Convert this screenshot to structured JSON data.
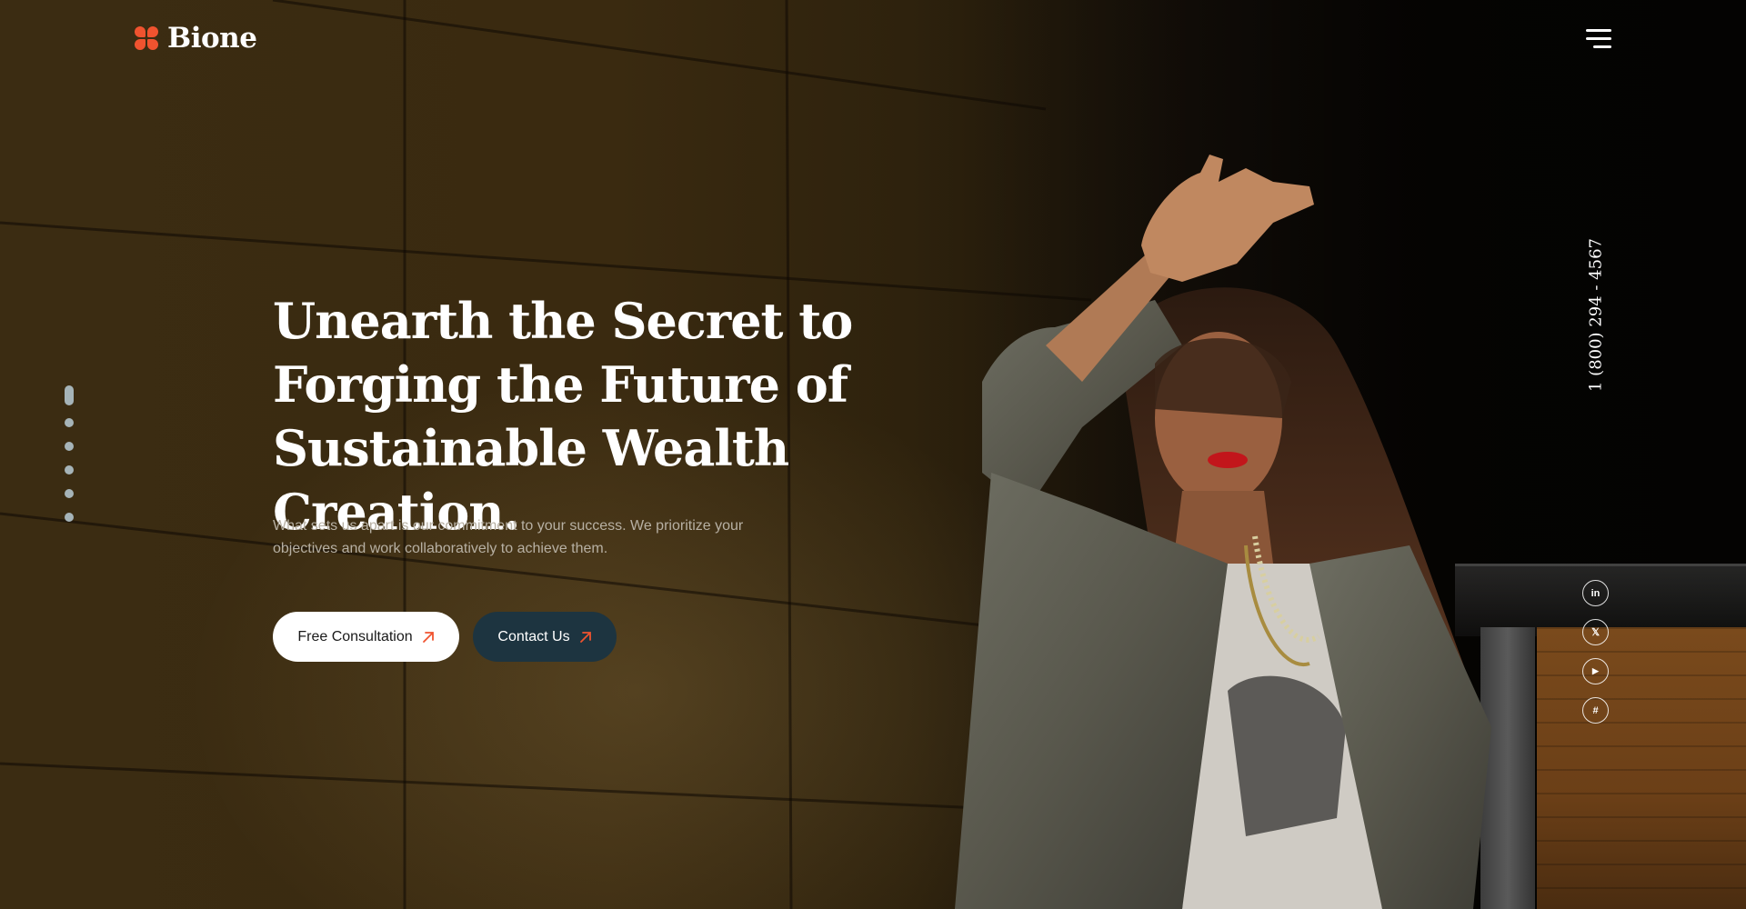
{
  "brand": {
    "name": "Bione",
    "accent_color": "#f0532f"
  },
  "header": {
    "menu_icon": "hamburger-menu-icon"
  },
  "slider": {
    "dot_count": 6,
    "active_index": 0
  },
  "hero": {
    "headline": "Unearth the Secret to Forging the Future of Sustainable Wealth Creation.",
    "subtext": "What sets us apart is our commitment to your success. We prioritize your objectives and work collaboratively to achieve them.",
    "primary_button": {
      "label": "Free Consultation",
      "icon": "arrow-up-right-icon"
    },
    "secondary_button": {
      "label": "Contact Us",
      "icon": "arrow-up-right-icon",
      "background": "#1d3440"
    }
  },
  "contact": {
    "phone": "1 (800) 294 - 4567"
  },
  "socials": [
    {
      "name": "linkedin",
      "icon": "linkedin-icon",
      "glyph": "in"
    },
    {
      "name": "x",
      "icon": "x-icon",
      "glyph": "𝕏"
    },
    {
      "name": "youtube",
      "icon": "youtube-icon",
      "glyph": "▶"
    },
    {
      "name": "slack",
      "icon": "slack-icon",
      "glyph": "#"
    }
  ]
}
